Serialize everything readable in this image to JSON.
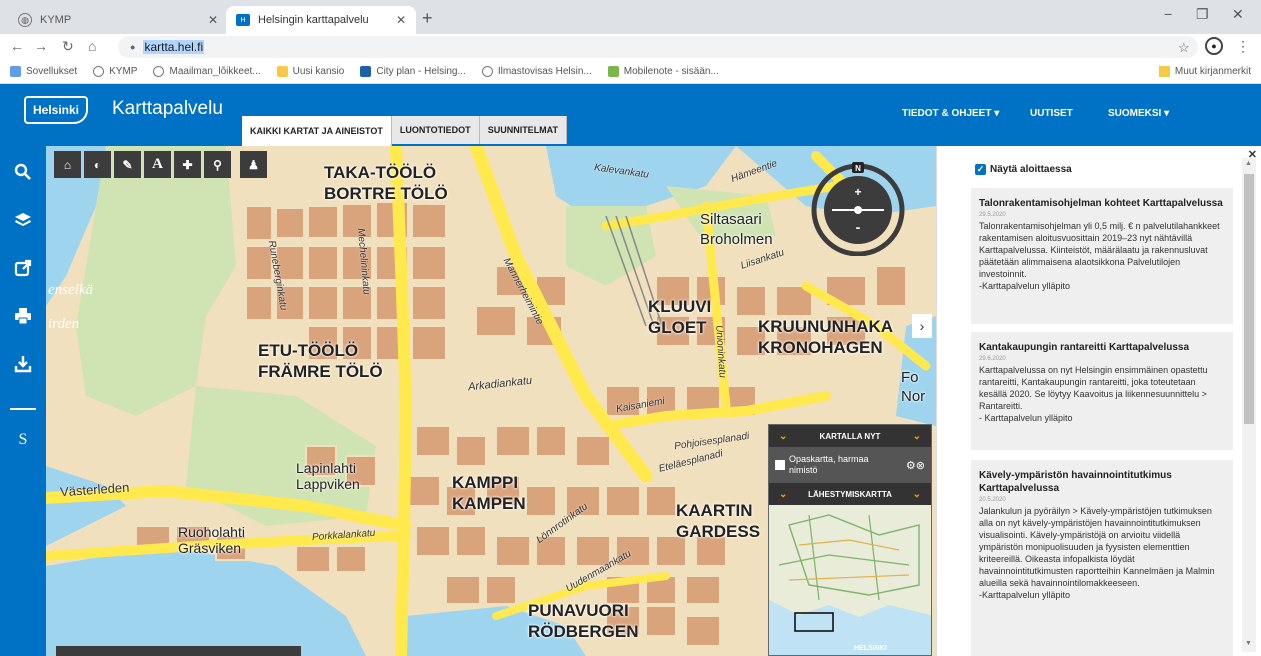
{
  "browser": {
    "tabs": [
      {
        "title": "KYMP",
        "active": false
      },
      {
        "title": "Helsingin karttapalvelu",
        "active": true
      }
    ],
    "url": "kartta.hel.fi",
    "bookmarks": [
      "Sovellukset",
      "KYMP",
      "Maailman_lõikkeet...",
      "Uusi kansio",
      "City plan - Helsing...",
      "Ilmastovisas Helsin...",
      "Mobilenote - sisään..."
    ],
    "bookmarks_other": "Muut kirjanmerkit"
  },
  "header": {
    "logo": "Helsinki",
    "title": "Karttapalvelu",
    "tabs": [
      "KAIKKI KARTAT JA AINEISTOT",
      "LUONTOTIEDOT",
      "SUUNNITELMAT"
    ],
    "nav": [
      "TIEDOT & OHJEET ▾",
      "UUTISET",
      "SUOMEKSI ▾"
    ]
  },
  "sidebar": {
    "icons": [
      "search-icon",
      "layers-icon",
      "share-icon",
      "print-icon",
      "download-icon"
    ],
    "lang_short": "S"
  },
  "map": {
    "districts": [
      {
        "fi": "TAKA-TÖÖLÖ",
        "sv": "BORTRE TÖLÖ"
      },
      {
        "fi": "Siltasaari",
        "sv": "Broholmen"
      },
      {
        "fi": "KLUUVI",
        "sv": "GLOET"
      },
      {
        "fi": "KRUUNUNHAKA",
        "sv": "KRONOHAGEN"
      },
      {
        "fi": "ETU-TÖÖLÖ",
        "sv": "FRÄMRE TÖLÖ"
      },
      {
        "fi": "Lapinlahti",
        "sv": "Lappviken"
      },
      {
        "fi": "KAMPPI",
        "sv": "KAMPEN"
      },
      {
        "fi": "KAARTIN",
        "sv": "GARDESS"
      },
      {
        "fi": "Ruoholahti",
        "sv": "Gräsviken"
      },
      {
        "fi": "PUNAVUORI",
        "sv": "RÖDBERGEN"
      }
    ],
    "streets": [
      "Mechelininkatu",
      "Mannerheimintie",
      "Arkadiankatu",
      "Runeberginkatu",
      "Kaisaniemi",
      "Pohjoisesplanadi",
      "Eteläesplanadi",
      "Porkkalankatu",
      "Lönnrotinkatu",
      "Uudenmaankatu",
      "Unioninkatu",
      "Västerleden",
      "Hämeentie",
      "Liisankatu",
      "Kalevankatu"
    ],
    "water": [
      "enselkä",
      "irden"
    ],
    "edge": [
      "Fo",
      "Nor"
    ],
    "overview": {
      "on_map_label": "KARTALLA NYT",
      "layer": "Opaskartta, harmaa nimistö",
      "minimap_label": "LÄHESTYMISKARTTA",
      "minimap_city": "HELSINKI"
    }
  },
  "news": {
    "show_at_start": "Näytä aloittaessa",
    "cards": [
      {
        "title": "Talonrakentamisohjelman kohteet Karttapalvelussa",
        "date": "29.5.2020",
        "body": "Talonrakentamisohjelman yli 0,5 milj. € n palvelutilahankkeet rakentamisen aloitusvuosittain 2019–23 nyt nähtävillä Karttapalvelussa. Kiinteistöt, määrälaatu ja rakennusluvat päätetään alimmaisena alaotsikkona Palvelutilojen investoinnit.",
        "sig": "-Karttapalvelun ylläpito"
      },
      {
        "title": "Kantakaupungin rantareitti Karttapalvelussa",
        "date": "29.6.2020",
        "body": "Karttapalvelussa on nyt Helsingin ensimmäinen opastettu rantareitti, Kantakaupungin rantareitti, joka toteutetaan kesällä 2020. Se löytyy Kaavoitus ja liikennesuunnittelu > Rantareitti.",
        "sig": "- Karttapalvelun ylläpito"
      },
      {
        "title": "Kävely-ympäristön havainnointitutkimus Karttapalvelussa",
        "date": "20.5.2020",
        "body": "Jalankulun ja pyöräilyn > Kävely-ympäristöjen tutkimuksen alla on nyt kävely-ympäristöjen havainnointitutkimuksen visualisointi. Kävely-ympäristöjä on arvioitu viidellä ympäristön monipuolisuuden ja fyysisten elementtien kriteereillä. Oikeasta infopalkista löydät havainnointitutkimusten raportteihin Kannelmäen ja Malmin alueilla sekä havainnointilomakkeeseen.",
        "sig": "-Karttapalvelun ylläpito"
      }
    ]
  },
  "colors": {
    "brand": "#0072c6",
    "land": "#f1e0bd",
    "park": "#cfe3b3",
    "water": "#9fd4ef",
    "road": "#ffe94d",
    "building": "#d9a37c"
  }
}
